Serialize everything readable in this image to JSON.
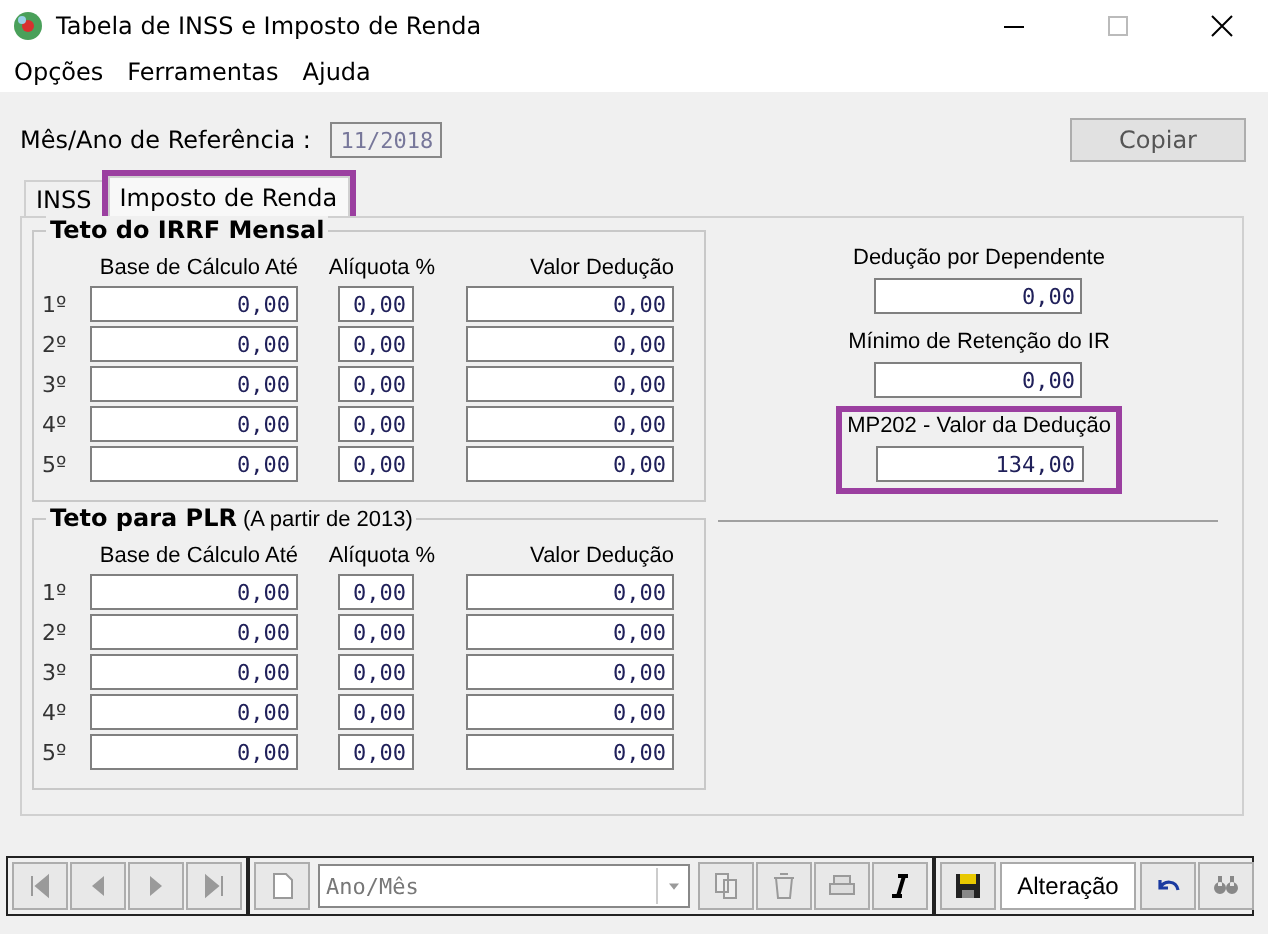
{
  "window": {
    "title": "Tabela de INSS e Imposto de Renda"
  },
  "menu": [
    "Opções",
    "Ferramentas",
    "Ajuda"
  ],
  "reference": {
    "label": "Mês/Ano de Referência :",
    "value": "11/2018"
  },
  "copy_button": "Copiar",
  "tabs": [
    {
      "label": "INSS",
      "selected": false,
      "highlighted": false
    },
    {
      "label": "Imposto de Renda",
      "selected": true,
      "highlighted": true
    }
  ],
  "groups": [
    {
      "title": "Teto do IRRF Mensal",
      "columns": [
        "Base de Cálculo Até",
        "Alíquota %",
        "Valor Dedução"
      ],
      "rows": [
        {
          "ordinal": "1º",
          "values": [
            "0,00",
            "0,00",
            "0,00"
          ]
        },
        {
          "ordinal": "2º",
          "values": [
            "0,00",
            "0,00",
            "0,00"
          ]
        },
        {
          "ordinal": "3º",
          "values": [
            "0,00",
            "0,00",
            "0,00"
          ]
        },
        {
          "ordinal": "4º",
          "values": [
            "0,00",
            "0,00",
            "0,00"
          ]
        },
        {
          "ordinal": "5º",
          "values": [
            "0,00",
            "0,00",
            "0,00"
          ]
        }
      ]
    },
    {
      "title": "Teto para PLR",
      "subtitle": "(A partir de 2013)",
      "columns": [
        "Base de Cálculo Até",
        "Alíquota %",
        "Valor Dedução"
      ],
      "rows": [
        {
          "ordinal": "1º",
          "values": [
            "0,00",
            "0,00",
            "0,00"
          ]
        },
        {
          "ordinal": "2º",
          "values": [
            "0,00",
            "0,00",
            "0,00"
          ]
        },
        {
          "ordinal": "3º",
          "values": [
            "0,00",
            "0,00",
            "0,00"
          ]
        },
        {
          "ordinal": "4º",
          "values": [
            "0,00",
            "0,00",
            "0,00"
          ]
        },
        {
          "ordinal": "5º",
          "values": [
            "0,00",
            "0,00",
            "0,00"
          ]
        }
      ]
    }
  ],
  "side_fields": [
    {
      "label": "Dedução por Dependente",
      "value": "0,00",
      "highlighted": false
    },
    {
      "label": "Mínimo de Retenção do IR",
      "value": "0,00",
      "highlighted": false
    },
    {
      "label": "MP202 - Valor da Dedução",
      "value": "134,00",
      "highlighted": true
    }
  ],
  "toolbar": {
    "combo_placeholder": "Ano/Mês",
    "mode": "Alteração"
  }
}
